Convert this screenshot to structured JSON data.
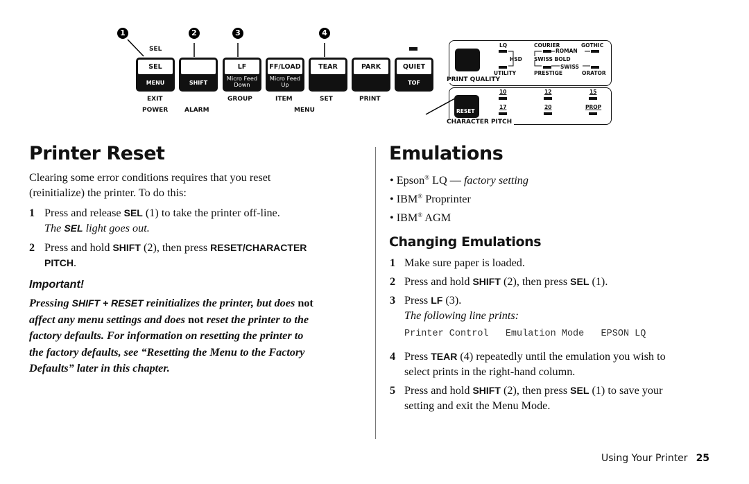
{
  "panel": {
    "callouts": [
      "1",
      "2",
      "3",
      "4"
    ],
    "sel_top_label": "SEL",
    "buttons": [
      {
        "top": "SEL",
        "bottom": "MENU",
        "below1": "EXIT",
        "below2": "POWER"
      },
      {
        "top": "",
        "bottom": "SHIFT",
        "below1": "",
        "below2": "ALARM"
      },
      {
        "top": "LF",
        "bottom1": "Micro Feed",
        "bottom2": "Down",
        "below1": "GROUP",
        "below2": ""
      },
      {
        "top": "FF/LOAD",
        "bottom1": "Micro Feed",
        "bottom2": "Up",
        "below1": "ITEM",
        "below2": ""
      },
      {
        "top": "TEAR",
        "bottom": "",
        "below1": "SET",
        "below2": ""
      },
      {
        "top": "PARK",
        "bottom": "",
        "below1": "PRINT",
        "below2": ""
      },
      {
        "top": "QUIET",
        "bottom": "TOF",
        "below1": "",
        "below2": ""
      }
    ],
    "menu_label": "MENU",
    "print_quality": {
      "title": "PRINT QUALITY",
      "lq": "LQ",
      "hsd": "HSD",
      "utility": "UTILITY",
      "courier": "COURIER",
      "gothic": "GOTHIC",
      "roman": "ROMAN",
      "swiss_bold": "SWISS BOLD",
      "swiss": "SWISS",
      "prestige": "PRESTIGE",
      "orator": "ORATOR"
    },
    "character_pitch": {
      "title": "CHARACTER PITCH",
      "reset": "RESET",
      "pitches": [
        "10",
        "12",
        "15",
        "17",
        "20",
        "PROP"
      ]
    }
  },
  "left": {
    "title": "Printer Reset",
    "intro_line1": "Clearing some error conditions requires that you reset",
    "intro_line2": "(reinitialize) the printer. To do this:",
    "steps": [
      {
        "num": "1",
        "a": "Press and release ",
        "k1": "SEL",
        "b": " (1) to take the printer off-line.",
        "note_a": "The ",
        "note_k": "SEL",
        "note_b": " light goes out."
      },
      {
        "num": "2",
        "a": "Press and hold ",
        "k1": "SHIFT",
        "b": " (2), then press ",
        "k2": "RESET/CHARACTER",
        "k3": "PITCH",
        "c": "."
      }
    ],
    "important": {
      "heading": "Important!",
      "l1_a": "Pressing ",
      "l1_k": "SHIFT + RESET",
      "l1_b": " reinitializes the printer, but does ",
      "l1_c": "not",
      "l2_a": "affect any menu settings and does ",
      "l2_b": "not",
      "l2_c": " reset the printer to the",
      "l3": "factory defaults. For information on resetting the printer to",
      "l4": "the factory defaults, see “Resetting the Menu to the Factory",
      "l5": "Defaults” later in this chapter."
    }
  },
  "right": {
    "title": "Emulations",
    "bullets": [
      {
        "brand": "Epson",
        "reg": "®",
        "rest": " LQ — ",
        "italic": "factory setting"
      },
      {
        "brand": "IBM",
        "reg": "®",
        "rest": " Proprinter",
        "italic": ""
      },
      {
        "brand": "IBM",
        "reg": "®",
        "rest": " AGM",
        "italic": ""
      }
    ],
    "subtitle": "Changing Emulations",
    "steps": [
      {
        "num": "1",
        "text": "Make sure paper is loaded."
      },
      {
        "num": "2",
        "a": "Press and hold ",
        "k1": "SHIFT",
        "b": " (2), then press ",
        "k2": "SEL",
        "c": " (1)."
      },
      {
        "num": "3",
        "a": "Press ",
        "k1": "LF",
        "b": " (3).",
        "note": "The following line prints:",
        "code": "Printer Control   Emulation Mode   EPSON LQ"
      },
      {
        "num": "4",
        "a": "Press ",
        "k1": "TEAR",
        "b": " (4) repeatedly until the emulation you wish to",
        "l2": "select prints in the right-hand column."
      },
      {
        "num": "5",
        "a": "Press and hold ",
        "k1": "SHIFT",
        "b": " (2), then press ",
        "k2": "SEL",
        "c": " (1) to save your",
        "l2": "setting and exit the Menu Mode."
      }
    ]
  },
  "footer": {
    "section": "Using Your Printer",
    "page": "25"
  }
}
